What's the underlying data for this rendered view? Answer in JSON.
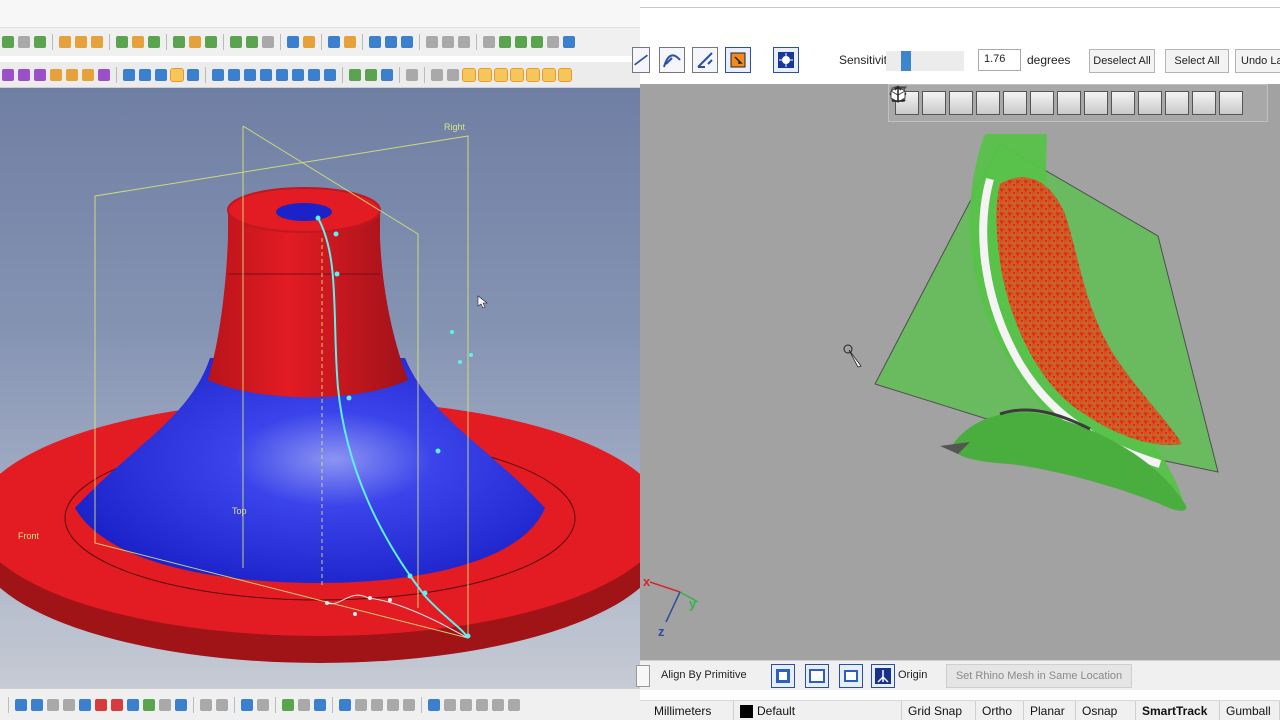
{
  "left_viewport": {
    "labels": {
      "right": "Right",
      "top": "Top",
      "front": "Front"
    }
  },
  "right_toolbar": {
    "sensitivity_label": "Sensitivity",
    "sensitivity_value": "1.76",
    "degrees_label": "degrees",
    "deselect_all": "Deselect All",
    "select_all": "Select All",
    "undo_last": "Undo La"
  },
  "axes": {
    "x": "x",
    "y": "y",
    "z": "z"
  },
  "bottom_bar": {
    "align_by_primitive": "Align By Primitive",
    "origin": "Origin",
    "set_mesh": "Set Rhino Mesh in Same Location"
  },
  "status_bar": {
    "units": "Millimeters",
    "layer": "Default",
    "grid_snap": "Grid Snap",
    "ortho": "Ortho",
    "planar": "Planar",
    "osnap": "Osnap",
    "smarttrack": "SmartTrack",
    "gumball": "Gumball",
    "active_toggle": "SmartTrack"
  },
  "colors": {
    "model_red": "#e31b23",
    "model_blue": "#1e27d8",
    "section_curve": "#5ff0f0",
    "plane_outline": "#d6e27a",
    "surface_green": "#58c24a",
    "viewport_gray": "#a2a2a2",
    "slider_blue": "#3b86cf"
  },
  "icons": {
    "toolbar": [
      "select-freeform-icon",
      "select-curve-icon",
      "select-plane-icon",
      "select-active-icon",
      "auto-select-icon"
    ],
    "viewbar": [
      "zoom-fit-icon",
      "zoom-icon",
      "pan-select-icon",
      "pan-icon",
      "zoom-window-icon",
      "view-front-icon",
      "view-back-icon",
      "view-left-icon",
      "view-right-icon",
      "view-top-icon",
      "view-bottom-icon",
      "view-iso-icon",
      "view-axis-icon"
    ],
    "bottom": [
      "fit-icon",
      "front-view-icon",
      "display-icon",
      "origin-icon"
    ]
  }
}
